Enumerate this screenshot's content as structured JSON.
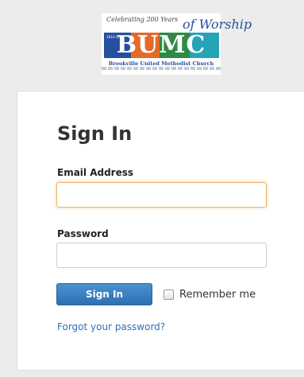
{
  "logo": {
    "tagline": "Celebrating 200 Years",
    "script": "of Worship",
    "letters": "BUMC",
    "years": "1814-2014",
    "church": "Brookville United Methodist Church"
  },
  "form": {
    "title": "Sign In",
    "email_label": "Email Address",
    "email_value": "",
    "password_label": "Password",
    "password_value": "",
    "submit_label": "Sign In",
    "remember_label": "Remember me",
    "remember_checked": false,
    "forgot_link": "Forgot your password?"
  },
  "colors": {
    "background": "#ececec",
    "primary_button": "#3a82c4",
    "link": "#2e70b3",
    "focus_border": "#e8b86c"
  }
}
